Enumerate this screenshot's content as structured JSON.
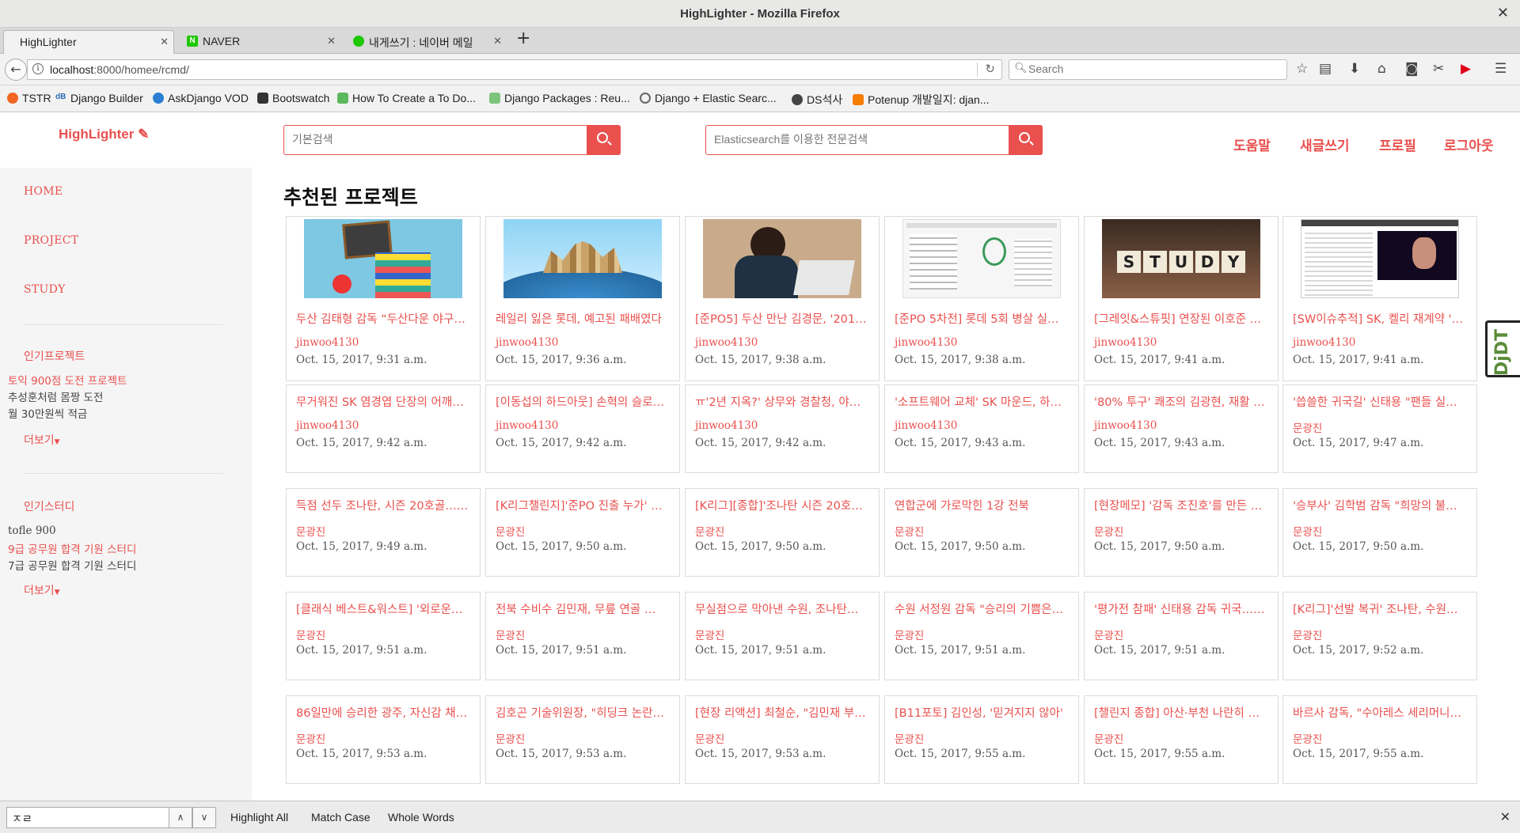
{
  "window": {
    "title": "HighLighter - Mozilla Firefox"
  },
  "tabs": [
    {
      "label": "HighLighter",
      "favicon": "page-icon",
      "active": true
    },
    {
      "label": "NAVER",
      "favicon": "naver-icon",
      "active": false
    },
    {
      "label": "내게쓰기 : 네이버 메일",
      "favicon": "naver-mail-icon",
      "active": false
    }
  ],
  "address": {
    "host": "localhost",
    "path": ":8000/homee/rcmd/"
  },
  "browser_search": {
    "placeholder": "Search"
  },
  "bookmarks": [
    "TSTR",
    "Django Builder",
    "AskDjango VOD",
    "Bootswatch",
    "How To Create a To Do...",
    "Django Packages : Reu...",
    "Django + Elastic Searc...",
    "DS석사",
    "Potenup 개발일지: djan..."
  ],
  "site": {
    "brand": "HighLighter",
    "basic_search_placeholder": "기본검색",
    "es_search_placeholder": "Elasticsearch를 이용한 전문검색",
    "top_links": [
      "도움말",
      "새글쓰기",
      "프로필",
      "로그아웃"
    ],
    "accent": "#e9504e"
  },
  "sidebar": {
    "nav": [
      "HOME",
      "PROJECT",
      "STUDY"
    ],
    "popular_projects_heading": "인기프로젝트",
    "popular_projects": [
      "토익 900점 도전 프로젝트",
      "추성훈처럼 몸짱 도전",
      "월 30만원씩 적금"
    ],
    "popular_studies_heading": "인기스터디",
    "popular_studies": [
      "tofle 900",
      "9급 공무원 합격 기원 스터디",
      "7급 공무원 합격 기원 스터디"
    ],
    "more_label": "더보기"
  },
  "section_title": "추천된 프로젝트",
  "cards": [
    {
      "title": "두산 김태형 감독 “두산다운 야구…",
      "author": "jinwoo4130",
      "date": "Oct. 15, 2017, 9:31 a.m."
    },
    {
      "title": "레일리 잃은 롯데, 예고된 패배였다",
      "author": "jinwoo4130",
      "date": "Oct. 15, 2017, 9:36 a.m."
    },
    {
      "title": "[준PO5] 두산 만난 김경문, '2016…",
      "author": "jinwoo4130",
      "date": "Oct. 15, 2017, 9:38 a.m."
    },
    {
      "title": "[준PO 5차전] 롯데 5회 병살 실…",
      "author": "jinwoo4130",
      "date": "Oct. 15, 2017, 9:38 a.m."
    },
    {
      "title": "[그레잇&스튜핏] 연장된 이호준 …",
      "author": "jinwoo4130",
      "date": "Oct. 15, 2017, 9:41 a.m."
    },
    {
      "title": "[SW이슈추적] SK, 켈리 재계약 '…",
      "author": "jinwoo4130",
      "date": "Oct. 15, 2017, 9:41 a.m."
    },
    {
      "title": "무거워진 SK 염경엽 단장의 어깨…",
      "author": "jinwoo4130",
      "date": "Oct. 15, 2017, 9:42 a.m."
    },
    {
      "title": "[이동섭의 하드아웃] 손혁의 슬로…",
      "author": "jinwoo4130",
      "date": "Oct. 15, 2017, 9:42 a.m."
    },
    {
      "title": "ㅠ'2년 지옥?' 상무와 경찰청, 야…",
      "author": "jinwoo4130",
      "date": "Oct. 15, 2017, 9:42 a.m."
    },
    {
      "title": "'소프트웨어 교체' SK 마운드, 하…",
      "author": "jinwoo4130",
      "date": "Oct. 15, 2017, 9:43 a.m."
    },
    {
      "title": "'80% 투구' 쾌조의 김광현, 재활 …",
      "author": "jinwoo4130",
      "date": "Oct. 15, 2017, 9:43 a.m."
    },
    {
      "title": "'씁쓸한 귀국길' 신태용 \"팬들 실…",
      "author": "문광진",
      "date": "Oct. 15, 2017, 9:47 a.m."
    },
    {
      "title": "득점 선두 조나탄, 시즌 20호골……",
      "author": "문광진",
      "date": "Oct. 15, 2017, 9:49 a.m."
    },
    {
      "title": "[K리그챌린지]'준PO 진출 누가' …",
      "author": "문광진",
      "date": "Oct. 15, 2017, 9:50 a.m."
    },
    {
      "title": "[K리그][종합]'조나탄 시즌 20호…",
      "author": "문광진",
      "date": "Oct. 15, 2017, 9:50 a.m."
    },
    {
      "title": "연합군에 가로막힌 1강 전북",
      "author": "문광진",
      "date": "Oct. 15, 2017, 9:50 a.m."
    },
    {
      "title": "[현장메모] '감독 조진호'를 만든 …",
      "author": "문광진",
      "date": "Oct. 15, 2017, 9:50 a.m."
    },
    {
      "title": "'승부사' 김학범 감독 \"희망의 불…",
      "author": "문광진",
      "date": "Oct. 15, 2017, 9:50 a.m."
    },
    {
      "title": "[클래식 베스트&워스트] '외로운…",
      "author": "문광진",
      "date": "Oct. 15, 2017, 9:51 a.m."
    },
    {
      "title": "전북 수비수 김민재, 무릎 연골 …",
      "author": "문광진",
      "date": "Oct. 15, 2017, 9:51 a.m."
    },
    {
      "title": "무실점으로 막아낸 수원, 조나탄…",
      "author": "문광진",
      "date": "Oct. 15, 2017, 9:51 a.m."
    },
    {
      "title": "수원 서정원 감독 \"승리의 기쁨은…",
      "author": "문광진",
      "date": "Oct. 15, 2017, 9:51 a.m."
    },
    {
      "title": "'평가전 참패' 신태용 감독 귀국……",
      "author": "문광진",
      "date": "Oct. 15, 2017, 9:51 a.m."
    },
    {
      "title": "[K리그]'선발 복귀' 조나탄, 수원…",
      "author": "문광진",
      "date": "Oct. 15, 2017, 9:52 a.m."
    },
    {
      "title": "86일만에 승리한 광주, 자신감 채…",
      "author": "문광진",
      "date": "Oct. 15, 2017, 9:53 a.m."
    },
    {
      "title": "김호곤 기술위원장, \"히딩크 논란…",
      "author": "문광진",
      "date": "Oct. 15, 2017, 9:53 a.m."
    },
    {
      "title": "[현장 리액션] 최철순, \"김민재 부…",
      "author": "문광진",
      "date": "Oct. 15, 2017, 9:53 a.m."
    },
    {
      "title": "[B11포토] 김인성, '믿겨지지 않아'",
      "author": "문광진",
      "date": "Oct. 15, 2017, 9:55 a.m."
    },
    {
      "title": "[챌린지 종합] 아산·부천 나란히 …",
      "author": "문광진",
      "date": "Oct. 15, 2017, 9:55 a.m."
    },
    {
      "title": "바르사 감독, \"수아레스 세리머니…",
      "author": "문광진",
      "date": "Oct. 15, 2017, 9:55 a.m."
    }
  ],
  "djdt_label": "DjDT",
  "findbar": {
    "query": "ㅈㄹ",
    "options": [
      "Highlight All",
      "Match Case",
      "Whole Words"
    ]
  }
}
